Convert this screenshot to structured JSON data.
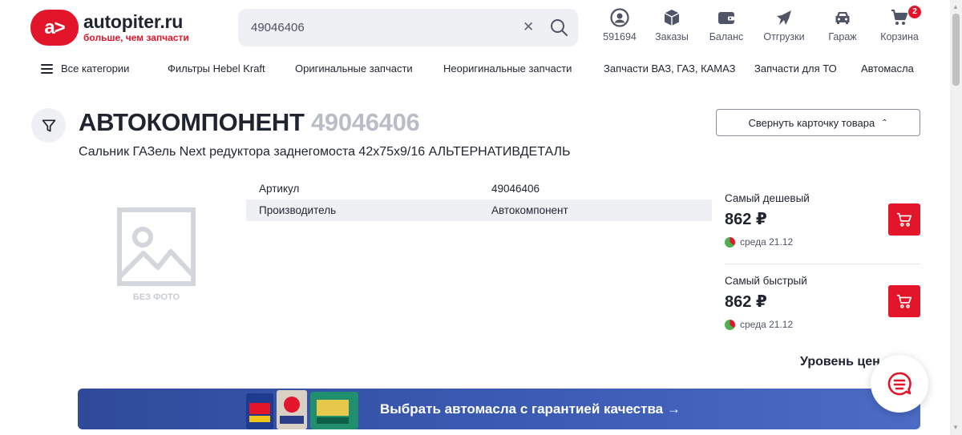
{
  "header": {
    "logo_text": "a>",
    "brand_name": "autopiter.ru",
    "brand_tagline": "больше, чем запчасти",
    "search": {
      "value": "49046406",
      "placeholder": ""
    },
    "icons": [
      {
        "icon": "user-icon",
        "label": "591694"
      },
      {
        "icon": "box-icon",
        "label": "Заказы"
      },
      {
        "icon": "wallet-icon",
        "label": "Баланс"
      },
      {
        "icon": "shipment-icon",
        "label": "Отгрузки"
      },
      {
        "icon": "car-icon",
        "label": "Гараж"
      },
      {
        "icon": "cart-icon",
        "label": "Корзина",
        "badge": "2"
      }
    ]
  },
  "nav": {
    "all_categories": "Все категории",
    "items": [
      "Фильтры Hebel Kraft",
      "Оригинальные запчасти",
      "Неоригинальные запчасти",
      "Запчасти ВАЗ, ГАЗ, КАМАЗ",
      "Запчасти для ТО",
      "Автомасла"
    ]
  },
  "product": {
    "brand": "АВТОКОМПОНЕНТ",
    "article": "49046406",
    "name": "Сальник ГАЗель Next редуктора заднегомоста 42х75х9/16 АЛЬТЕРНАТИВДЕТАЛЬ",
    "collapse_label": "Свернуть карточку товара",
    "no_photo": "БЕЗ ФОТО",
    "specs": [
      {
        "key": "Артикул",
        "value": "49046406"
      },
      {
        "key": "Производитель",
        "value": "Автокомпонент"
      }
    ]
  },
  "offers": [
    {
      "title": "Самый дешевый",
      "price": "862 ₽",
      "delivery": "среда 21.12"
    },
    {
      "title": "Самый быстрый",
      "price": "862 ₽",
      "delivery": "среда 21.12"
    }
  ],
  "price_level": "Уровень цен",
  "banner": {
    "text": "Выбрать автомасла с гарантией качества →"
  },
  "colors": {
    "accent": "#e3152b",
    "banner": "#3d5db6",
    "text": "#1f2430"
  }
}
